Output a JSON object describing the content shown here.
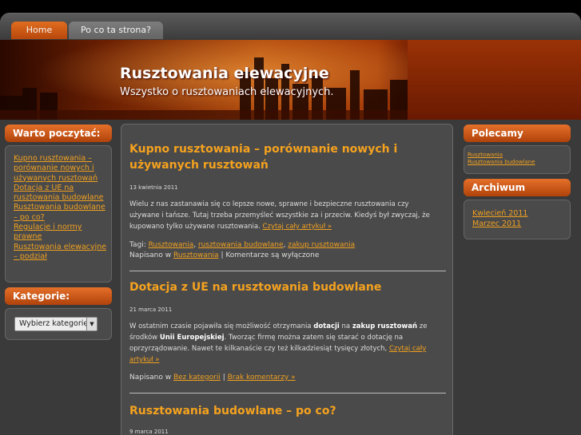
{
  "nav": {
    "tabs": [
      {
        "label": "Home"
      },
      {
        "label": "Po co ta strona?"
      }
    ]
  },
  "header": {
    "title": "Rusztowania elewacyjne",
    "description": "Wszystko o rusztowaniach elewacyjnych."
  },
  "left_sidebar": {
    "warto": {
      "title": "Warto poczytać:",
      "links": [
        "Kupno rusztowania – porównanie nowych i używanych rusztowań",
        "Dotacja z UE na rusztowania budowlane",
        "Rusztowania budowlane – po co?",
        "Regulacje i normy prawne",
        "Rusztowania elewacyjne – podział"
      ]
    },
    "kategorie": {
      "title": "Kategorie:",
      "select_value": "Wybierz kategorię"
    }
  },
  "posts": [
    {
      "title": "Kupno rusztowania – porównanie nowych i używanych rusztowań",
      "date": "13 kwietnia 2011",
      "body_lines": [
        "Wielu z nas zastanawia się co lepsze nowe, sprawne i bezpieczne rusztowania czy",
        "używane i tańsze.  Tutaj trzeba przemyśleć wszystkie za i przeciw. Kiedyś był zwyczaj, że",
        "kupowano tylko używane rusztowania. "
      ],
      "read_more": "Czytaj cały artykuł »",
      "tags_label": "Tagi: ",
      "tags": [
        "Rusztowania",
        "rusztowania budowlane",
        "zakup rusztowania"
      ],
      "posted_in": "Napisano w ",
      "category": "Rusztowania",
      "comments": " | Komentarze są wyłączone"
    },
    {
      "title": "Dotacja z UE na rusztowania budowlane",
      "date": "21 marca 2011",
      "body": {
        "p1": "W ostatnim czasie pojawiła się możliwość otrzymania ",
        "b1": "dotacji",
        "p2": " na ",
        "b2": "zakup rusztowań",
        "p3": " ze",
        "p4": "środków ",
        "b3": "Unii Europejskiej",
        "p5": ". Tworząc firmę można zatem się starać o dotację na",
        "p6": "oprzyrządowanie. Nawet te kilkanaście czy też kilkadziesiąt  tysięcy złotych, "
      },
      "read_more_1": "Czytaj cały",
      "read_more_2": "artykuł »",
      "posted_in": "Napisano w ",
      "category": "Bez kategorii",
      "sep": " | ",
      "comments": "Brak komentarzy »"
    },
    {
      "title": "Rusztowania budowlane – po co?",
      "date": "9 marca 2011"
    }
  ],
  "right_sidebar": {
    "polecamy": {
      "title": "Polecamy",
      "links": [
        "Rusztowania",
        "Rusztowania budowlane"
      ]
    },
    "archiwum": {
      "title": "Archiwum",
      "links": [
        "Kwiecień 2011",
        "Marzec 2011"
      ]
    }
  },
  "colors": {
    "accent": "#e06d1f",
    "link": "#f0a020",
    "background": "#3a3a3a"
  }
}
